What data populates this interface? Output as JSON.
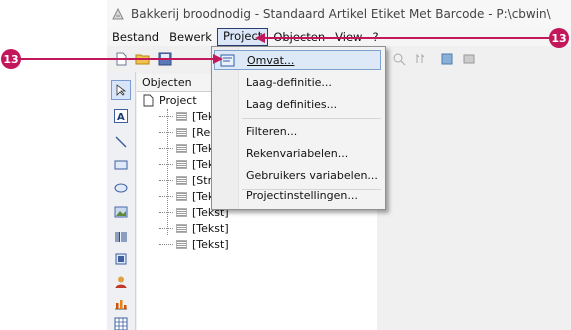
{
  "window": {
    "title": "Bakkerij broodnodig - Standaard Artikel Etiket Met Barcode  - P:\\cbwin\\"
  },
  "menubar": {
    "items": [
      {
        "label": "Bestand"
      },
      {
        "label": "Bewerk"
      },
      {
        "label": "Project"
      },
      {
        "label": "Objecten"
      },
      {
        "label": "View"
      },
      {
        "label": "?"
      }
    ]
  },
  "toolbar": {
    "icons": [
      "new-file-icon",
      "open-folder-icon",
      "save-icon",
      "project-scope-icon",
      "zoom-icon",
      "number-icon",
      "layer-icon",
      "settings-icon"
    ]
  },
  "lefttools": {
    "icons": [
      "pointer-icon",
      "text-tool-icon",
      "line-tool-icon",
      "rectangle-tool-icon",
      "ellipse-tool-icon",
      "image-tool-icon",
      "barcode-tool-icon",
      "shape-tool-icon",
      "user-icon",
      "chart-icon",
      "table-icon"
    ]
  },
  "objects_panel": {
    "header": "Objecten",
    "root": "Project",
    "nodes": [
      "[Tekst]",
      "[Rechth",
      "[Tekst]",
      "[Tekst]",
      "[Streepj",
      "[Tekeni",
      "[Tekst]",
      "[Tekst]",
      "[Tekst]"
    ]
  },
  "dropdown": {
    "items": [
      {
        "label": "Omvat...",
        "icon": "project-scope-icon",
        "highlighted": true
      },
      {
        "label": "Laag-definitie..."
      },
      {
        "label": "Laag definities..."
      },
      {
        "label": "Filteren..."
      },
      {
        "label": "Rekenvariabelen..."
      },
      {
        "label": "Gebruikers variabelen..."
      },
      {
        "label": "Projectinstellingen..."
      }
    ]
  },
  "callouts": {
    "left": "13",
    "right": "13",
    "color": "#c2185b"
  }
}
